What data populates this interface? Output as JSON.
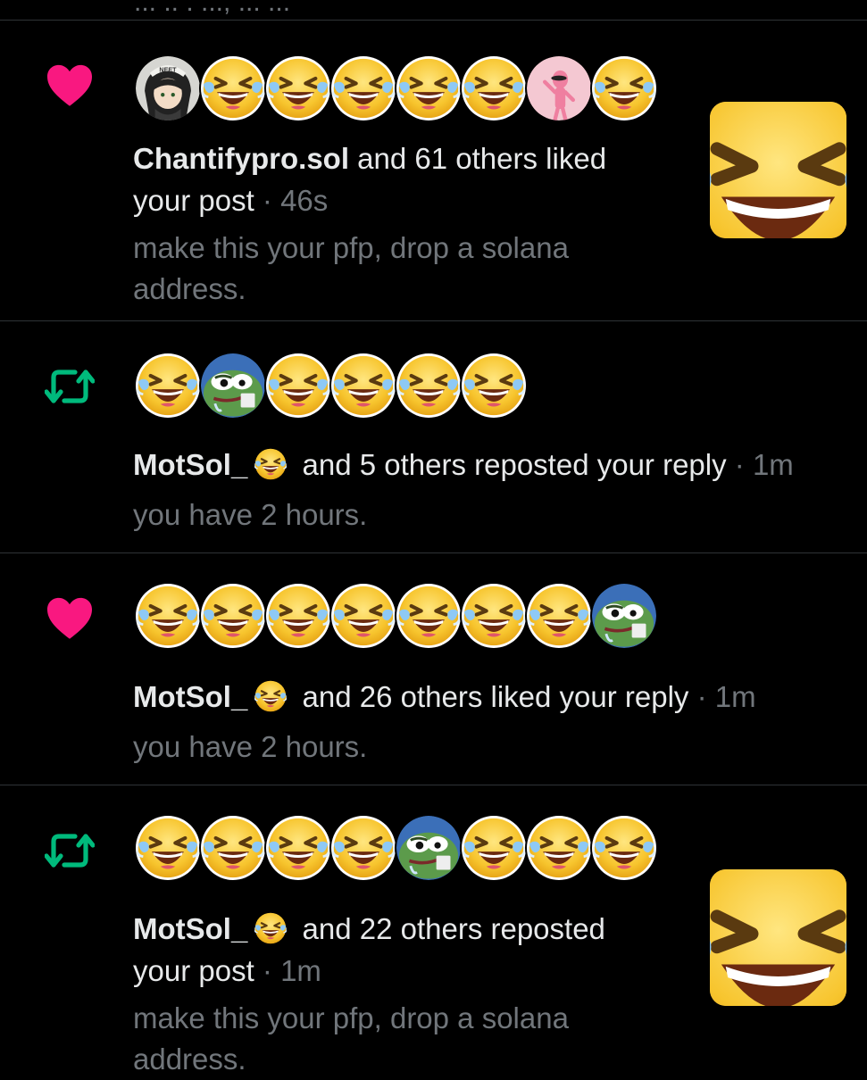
{
  "partial_top_text": "... .. . ..., ... ...",
  "notifications": [
    {
      "type": "like",
      "type_icon": "heart-icon",
      "avatars": [
        "neet-girl-avatar",
        "laughing-crying-emoji",
        "laughing-crying-emoji",
        "laughing-crying-emoji",
        "laughing-crying-emoji",
        "laughing-crying-emoji",
        "pink-panther-avatar",
        "laughing-crying-emoji"
      ],
      "name": "Chantifypro.sol",
      "name_emoji": "",
      "action": " and 61 others liked",
      "action2": "your post",
      "time": " · 46s",
      "subtext_line1": "make this your pfp, drop a solana",
      "subtext_line2": "address."
    },
    {
      "type": "repost",
      "type_icon": "repost-icon",
      "avatars": [
        "laughing-crying-emoji",
        "pepe-frog-avatar",
        "laughing-crying-emoji",
        "laughing-crying-emoji",
        "laughing-crying-emoji",
        "laughing-crying-emoji"
      ],
      "name": "MotSol_",
      "name_emoji": "laughing-crying-emoji",
      "action": " and 5 others reposted your reply",
      "time": " · 1m",
      "subtext_line1": "you have 2 hours."
    },
    {
      "type": "like",
      "type_icon": "heart-icon",
      "avatars": [
        "laughing-crying-emoji",
        "laughing-crying-emoji",
        "laughing-crying-emoji",
        "laughing-crying-emoji",
        "laughing-crying-emoji",
        "laughing-crying-emoji",
        "laughing-crying-emoji",
        "pepe-frog-avatar"
      ],
      "name": "MotSol_",
      "name_emoji": "laughing-crying-emoji",
      "action": " and 26 others liked your reply",
      "time": " · 1m",
      "subtext_line1": "you have 2 hours."
    },
    {
      "type": "repost",
      "type_icon": "repost-icon",
      "avatars": [
        "laughing-crying-emoji",
        "laughing-crying-emoji",
        "laughing-crying-emoji",
        "laughing-crying-emoji",
        "pepe-frog-avatar",
        "laughing-crying-emoji",
        "laughing-crying-emoji",
        "laughing-crying-emoji"
      ],
      "name": "MotSol_",
      "name_emoji": "laughing-crying-emoji",
      "action": " and 22 others reposted",
      "action2": "your post",
      "time": " · 1m",
      "subtext_line1": "make this your pfp, drop a solana",
      "subtext_line2": "address."
    }
  ],
  "colors": {
    "background": "#000000",
    "divider": "#2f3336",
    "heart": "#f91880",
    "repost": "#00ba7c",
    "secondary_text": "#71767b",
    "primary_text": "#e7e9ea"
  }
}
